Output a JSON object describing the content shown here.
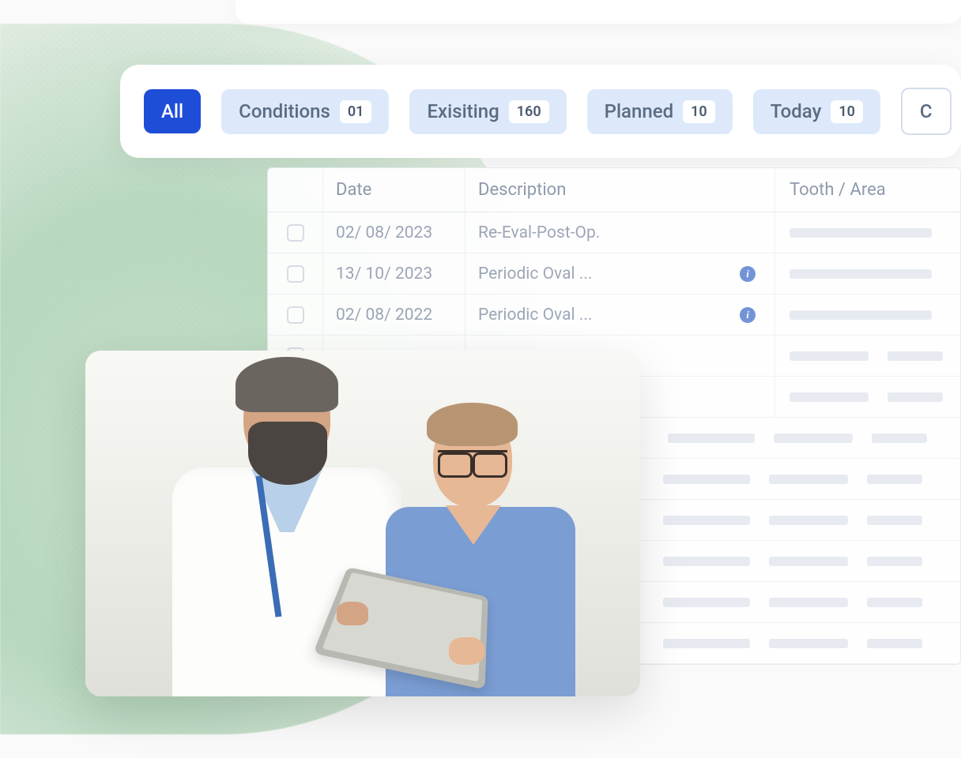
{
  "filters": {
    "all": {
      "label": "All"
    },
    "conditions": {
      "label": "Conditions",
      "count": "01"
    },
    "existing": {
      "label": "Exisiting",
      "count": "160"
    },
    "planned": {
      "label": "Planned",
      "count": "10"
    },
    "today": {
      "label": "Today",
      "count": "10"
    },
    "overflow": {
      "label": "C"
    }
  },
  "table": {
    "headers": {
      "date": "Date",
      "description": "Description",
      "tooth": "Tooth / Area"
    },
    "rows": [
      {
        "date": "02/ 08/ 2023",
        "description": "Re-Eval-Post-Op.",
        "info": false
      },
      {
        "date": "13/ 10/ 2023",
        "description": "Periodic Oval ...",
        "info": true
      },
      {
        "date": "02/ 08/ 2022",
        "description": "Periodic Oval ...",
        "info": true
      }
    ]
  }
}
